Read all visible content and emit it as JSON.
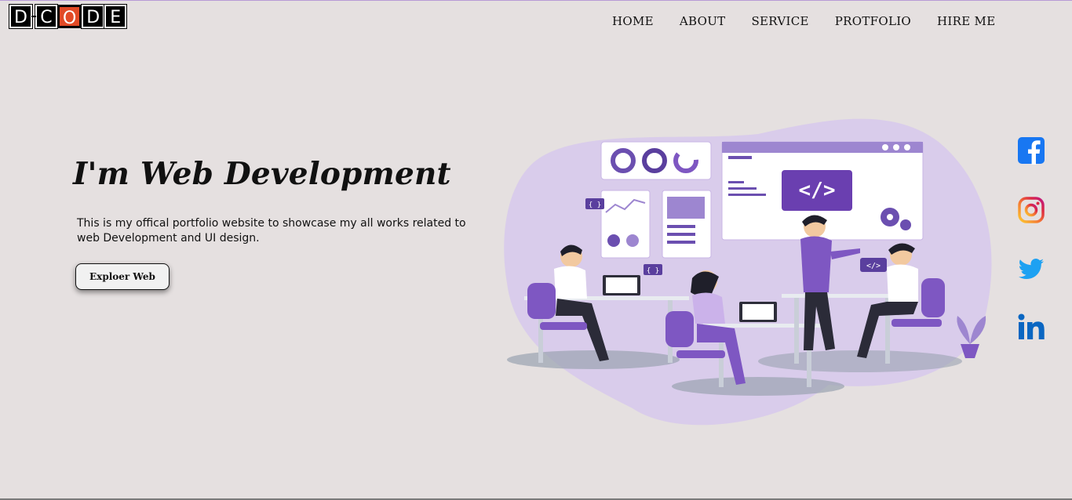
{
  "logo": {
    "letters": [
      "D",
      "C",
      "O",
      "D",
      "E"
    ]
  },
  "nav": {
    "items": [
      "HOME",
      "ABOUT",
      "SERVICE",
      "PROTFOLIO",
      "HIRE ME"
    ]
  },
  "hero": {
    "title": "I'm Web Development",
    "description": "This is my offical portfolio website to showcase my all works related to web Development and UI design.",
    "button_label": "Exploer Web"
  },
  "illustration": {
    "code_tag": "</>",
    "braces": "{ }"
  },
  "social": {
    "icons": [
      "facebook-icon",
      "instagram-icon",
      "twitter-icon",
      "linkedin-icon"
    ]
  },
  "colors": {
    "background": "#e5e0e0",
    "accent_purple": "#7e57c2",
    "logo_red": "#e24a26",
    "facebook": "#1877f2",
    "twitter": "#1da1f2",
    "linkedin": "#0a66c2"
  }
}
